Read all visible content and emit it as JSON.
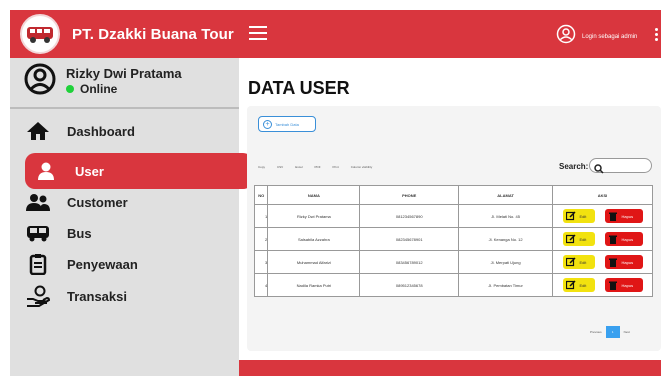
{
  "brand": {
    "title": "PT. Dzakki Buana Tour",
    "logo_icon": "bus-logo-icon"
  },
  "profile": {
    "name": "Rizky Dwi Pratama",
    "status": "Online",
    "status_color": "#1fd13a"
  },
  "sidebar": {
    "items": [
      {
        "label": "Dashboard",
        "icon": "home-icon",
        "active": false
      },
      {
        "label": "User",
        "icon": "user-icon",
        "active": true
      },
      {
        "label": "Customer",
        "icon": "users-icon",
        "active": false
      },
      {
        "label": "Bus",
        "icon": "bus-icon",
        "active": false
      },
      {
        "label": "Penyewaan",
        "icon": "clipboard-icon",
        "active": false
      },
      {
        "label": "Transaksi",
        "icon": "hand-money-icon",
        "active": false
      }
    ]
  },
  "topbar": {
    "login_text": "Login sebagai admin"
  },
  "main": {
    "title": "DATA USER",
    "add_button": "Tambah Data",
    "search_label": "Search:",
    "controls": [
      "Copy",
      "CSV",
      "Excel",
      "PDF",
      "Print",
      "Column visibility"
    ],
    "table": {
      "headers": [
        "NO",
        "NAMA",
        "PHONE",
        "ALAMAT",
        "AKSI"
      ],
      "rows": [
        {
          "no": "1",
          "nama": "Rizky Dwi Pratama",
          "phone": "081234567890",
          "alamat": "Jl. Melati No. 45"
        },
        {
          "no": "2",
          "nama": "Salsabila Azzahra",
          "phone": "082345678901",
          "alamat": "Jl. Kenanga No. 12"
        },
        {
          "no": "3",
          "nama": "Muhammad Alfarizi",
          "phone": "083456789012",
          "alamat": "Jl. Merpati Ujung"
        },
        {
          "no": "4",
          "nama": "Nadila Ramka Putri",
          "phone": "089512345678",
          "alamat": "Jl. Pembatan Timur"
        }
      ],
      "edit_label": "Edit",
      "delete_label": "Hapus"
    },
    "pager": {
      "previous": "Previous",
      "current": "1",
      "next": "Next"
    }
  },
  "colors": {
    "accent": "#d9363e",
    "sidebar_bg": "#e0e0e0",
    "edit": "#f2e20f",
    "delete": "#e01616",
    "link": "#3a8fd8"
  }
}
